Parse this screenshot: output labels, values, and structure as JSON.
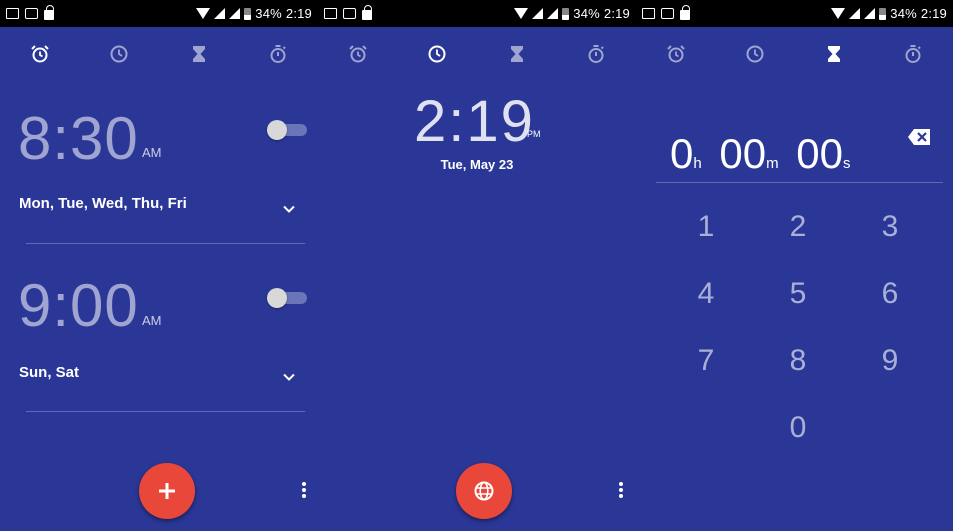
{
  "status_bar": {
    "battery": "34%",
    "time": "2:19"
  },
  "tabs": [
    {
      "name": "alarm",
      "icon": "alarm-clock-icon"
    },
    {
      "name": "clock",
      "icon": "clock-icon"
    },
    {
      "name": "timer",
      "icon": "hourglass-icon"
    },
    {
      "name": "stopwatch",
      "icon": "stopwatch-icon"
    }
  ],
  "alarm_screen": {
    "alarms": [
      {
        "time": "8:30",
        "ampm": "AM",
        "days": "Mon, Tue, Wed, Thu, Fri",
        "enabled": false
      },
      {
        "time": "9:00",
        "ampm": "AM",
        "days": "Sun, Sat",
        "enabled": false
      }
    ],
    "fab_icon": "plus-icon"
  },
  "clock_screen": {
    "time": "2:19",
    "ampm": "PM",
    "date": "Tue, May 23",
    "fab_icon": "globe-icon"
  },
  "timer_screen": {
    "hours": "0",
    "hours_unit": "h",
    "minutes": "00",
    "minutes_unit": "m",
    "seconds": "00",
    "seconds_unit": "s",
    "keys": [
      "1",
      "2",
      "3",
      "4",
      "5",
      "6",
      "7",
      "8",
      "9",
      "0"
    ]
  },
  "colors": {
    "background": "#2b3797",
    "fab": "#e8473a",
    "status_bar": "#000000"
  }
}
